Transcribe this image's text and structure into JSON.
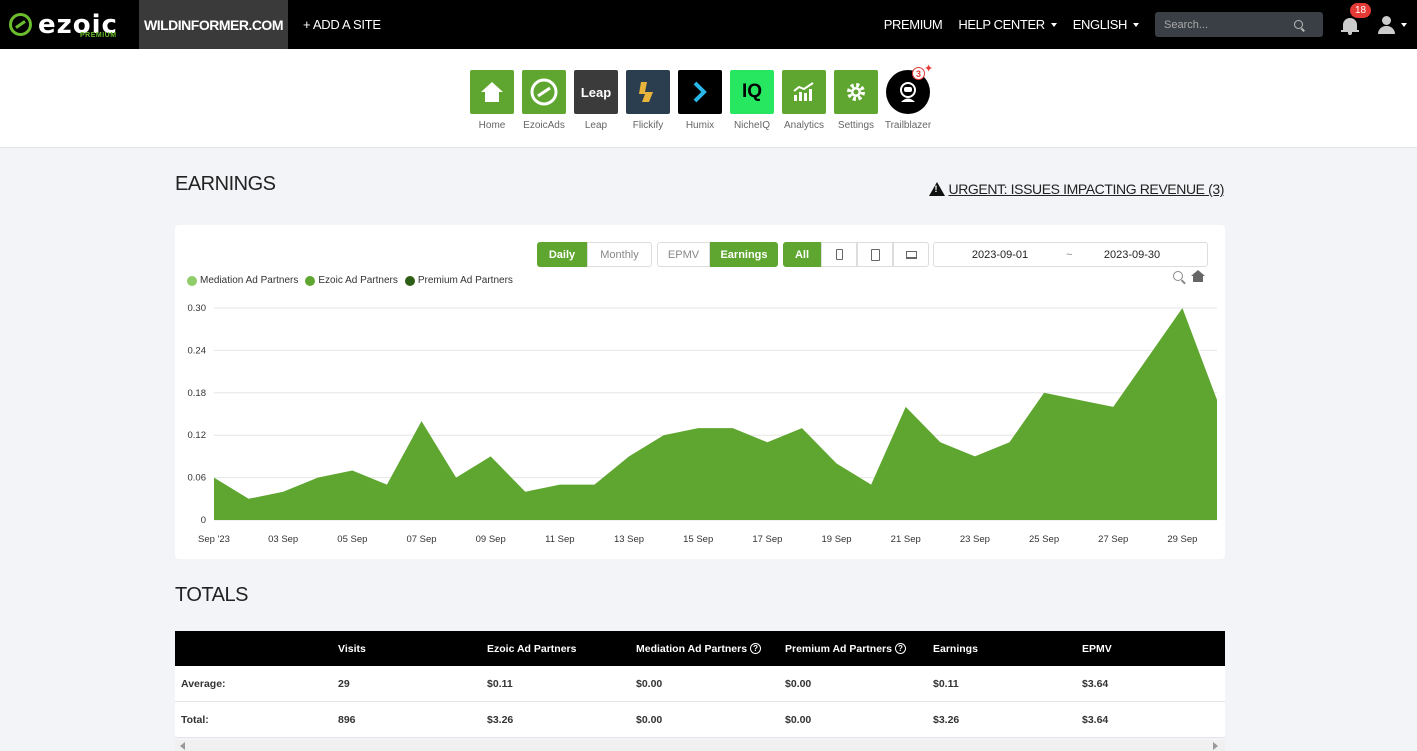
{
  "topbar": {
    "logo_text": "ezoic",
    "logo_sub": "PREMIUM",
    "site": "WILDINFORMER.COM",
    "add_site": "+ ADD A SITE",
    "premium": "PREMIUM",
    "help_center": "HELP CENTER",
    "language": "ENGLISH",
    "search_placeholder": "Search...",
    "notifications": "18"
  },
  "apps": [
    {
      "label": "Home",
      "icon": "home-icon"
    },
    {
      "label": "EzoicAds",
      "icon": "ezoicads-icon"
    },
    {
      "label": "Leap",
      "icon": "leap-icon",
      "tile_text": "Leap"
    },
    {
      "label": "Flickify",
      "icon": "flickify-icon"
    },
    {
      "label": "Humix",
      "icon": "humix-icon"
    },
    {
      "label": "NicheIQ",
      "icon": "nicheiq-icon",
      "tile_text": "IQ"
    },
    {
      "label": "Analytics",
      "icon": "analytics-icon"
    },
    {
      "label": "Settings",
      "icon": "gear-icon"
    },
    {
      "label": "Trailblazer",
      "icon": "trailblazer-icon",
      "badge": "3"
    }
  ],
  "earnings": {
    "title": "EARNINGS",
    "urgent": "URGENT: ISSUES IMPACTING REVENUE (3)",
    "period_buttons": [
      "Daily",
      "Monthly"
    ],
    "metric_buttons": [
      "EPMV",
      "Earnings"
    ],
    "device_buttons": [
      "All"
    ],
    "date_start": "2023-09-01",
    "date_sep": "~",
    "date_end": "2023-09-30"
  },
  "colors": {
    "accent": "#5ea62f",
    "mediation": "#8fcc6a",
    "ezoic": "#5ea62f",
    "premium": "#2d5e16"
  },
  "chart_data": {
    "type": "area",
    "legend": [
      "Mediation Ad Partners",
      "Ezoic Ad Partners",
      "Premium Ad Partners"
    ],
    "x": [
      "Sep '23",
      "02 Sep",
      "03 Sep",
      "04 Sep",
      "05 Sep",
      "06 Sep",
      "07 Sep",
      "08 Sep",
      "09 Sep",
      "10 Sep",
      "11 Sep",
      "12 Sep",
      "13 Sep",
      "14 Sep",
      "15 Sep",
      "16 Sep",
      "17 Sep",
      "18 Sep",
      "19 Sep",
      "20 Sep",
      "21 Sep",
      "22 Sep",
      "23 Sep",
      "24 Sep",
      "25 Sep",
      "26 Sep",
      "27 Sep",
      "28 Sep",
      "29 Sep",
      "30 Sep"
    ],
    "x_tick_labels": [
      "Sep '23",
      "03 Sep",
      "05 Sep",
      "07 Sep",
      "09 Sep",
      "11 Sep",
      "13 Sep",
      "15 Sep",
      "17 Sep",
      "19 Sep",
      "21 Sep",
      "23 Sep",
      "25 Sep",
      "27 Sep",
      "29 Sep"
    ],
    "series": [
      {
        "name": "Ezoic Ad Partners",
        "values": [
          0.06,
          0.03,
          0.04,
          0.06,
          0.07,
          0.05,
          0.14,
          0.06,
          0.09,
          0.04,
          0.05,
          0.05,
          0.09,
          0.12,
          0.13,
          0.13,
          0.11,
          0.13,
          0.08,
          0.05,
          0.16,
          0.11,
          0.09,
          0.11,
          0.18,
          0.17,
          0.16,
          0.23,
          0.3,
          0.17
        ]
      }
    ],
    "y_ticks": [
      "0",
      "0.06",
      "0.12",
      "0.18",
      "0.24",
      "0.30"
    ],
    "ylim": [
      0,
      0.3
    ],
    "grid": true
  },
  "totals": {
    "title": "TOTALS",
    "headers": [
      "",
      "Visits",
      "Ezoic Ad Partners",
      "Mediation Ad Partners",
      "Premium Ad Partners",
      "Earnings",
      "EPMV"
    ],
    "rows": [
      [
        "Average:",
        "29",
        "$0.11",
        "$0.00",
        "$0.00",
        "$0.11",
        "$3.64"
      ],
      [
        "Total:",
        "896",
        "$3.26",
        "$0.00",
        "$0.00",
        "$3.26",
        "$3.64"
      ]
    ]
  }
}
